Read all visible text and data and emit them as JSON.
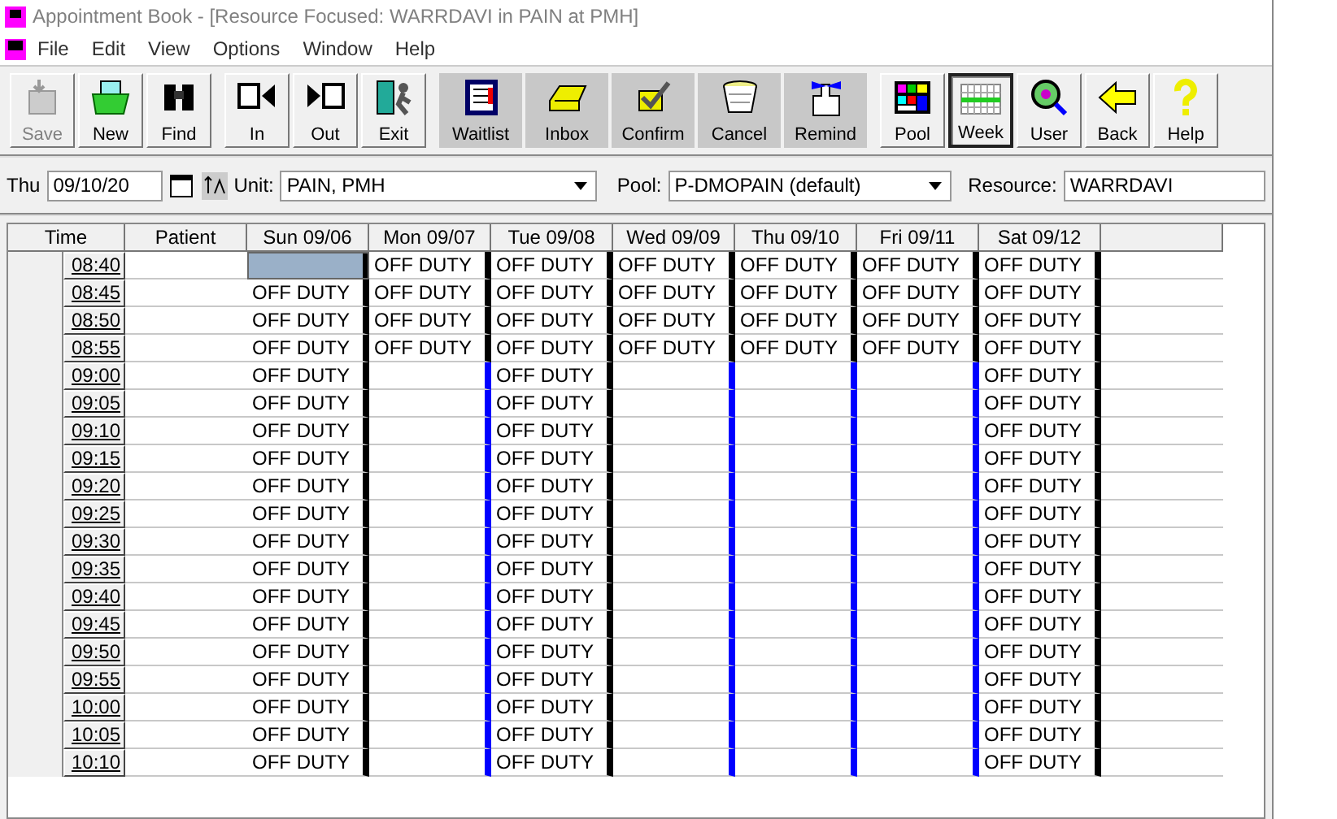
{
  "window": {
    "title": "Appointment Book - [Resource Focused:  WARRDAVI in PAIN at PMH]"
  },
  "menu": [
    "File",
    "Edit",
    "View",
    "Options",
    "Window",
    "Help"
  ],
  "toolbar": [
    {
      "label": "Save",
      "disabled": true,
      "selected": false
    },
    {
      "label": "New",
      "disabled": false,
      "selected": false
    },
    {
      "label": "Find",
      "disabled": false,
      "selected": false
    },
    {
      "label": "In",
      "disabled": false,
      "selected": false
    },
    {
      "label": "Out",
      "disabled": false,
      "selected": false
    },
    {
      "label": "Exit",
      "disabled": false,
      "selected": false
    },
    {
      "label": "Waitlist",
      "disabled": false,
      "selected": false
    },
    {
      "label": "Inbox",
      "disabled": false,
      "selected": false
    },
    {
      "label": "Confirm",
      "disabled": false,
      "selected": false
    },
    {
      "label": "Cancel",
      "disabled": false,
      "selected": false
    },
    {
      "label": "Remind",
      "disabled": false,
      "selected": false
    },
    {
      "label": "Pool",
      "disabled": false,
      "selected": false
    },
    {
      "label": "Week",
      "disabled": false,
      "selected": true
    },
    {
      "label": "User",
      "disabled": false,
      "selected": false
    },
    {
      "label": "Back",
      "disabled": false,
      "selected": false
    },
    {
      "label": "Help",
      "disabled": false,
      "selected": false
    }
  ],
  "filters": {
    "day": "Thu",
    "date": "09/10/20",
    "unit_label": "Unit:",
    "unit": "PAIN, PMH",
    "pool_label": "Pool:",
    "pool": "P-DMOPAIN (default)",
    "resource_label": "Resource:",
    "resource": "WARRDAVI"
  },
  "grid": {
    "time_header": "Time",
    "patient_header": "Patient",
    "times": [
      "08:40",
      "08:45",
      "08:50",
      "08:55",
      "09:00",
      "09:05",
      "09:10",
      "09:15",
      "09:20",
      "09:25",
      "09:30",
      "09:35",
      "09:40",
      "09:45",
      "09:50",
      "09:55",
      "10:00",
      "10:05",
      "10:10"
    ],
    "days": [
      {
        "label": "Sun 09/06",
        "slots": [
          {
            "selected": true,
            "kind": "blocked"
          },
          {
            "text": "OFF DUTY",
            "selected": false,
            "kind": "blocked"
          },
          {
            "text": "OFF DUTY",
            "selected": false,
            "kind": "blocked"
          },
          {
            "text": "OFF DUTY",
            "selected": false,
            "kind": "blocked"
          },
          {
            "text": "OFF DUTY",
            "selected": false,
            "kind": "blocked"
          },
          {
            "text": "OFF DUTY",
            "selected": false,
            "kind": "blocked"
          },
          {
            "text": "OFF DUTY",
            "selected": false,
            "kind": "blocked"
          },
          {
            "text": "OFF DUTY",
            "selected": false,
            "kind": "blocked"
          },
          {
            "text": "OFF DUTY",
            "selected": false,
            "kind": "blocked"
          },
          {
            "text": "OFF DUTY",
            "selected": false,
            "kind": "blocked"
          },
          {
            "text": "OFF DUTY",
            "selected": false,
            "kind": "blocked"
          },
          {
            "text": "OFF DUTY",
            "selected": false,
            "kind": "blocked"
          },
          {
            "text": "OFF DUTY",
            "selected": false,
            "kind": "blocked"
          },
          {
            "text": "OFF DUTY",
            "selected": false,
            "kind": "blocked"
          },
          {
            "text": "OFF DUTY",
            "selected": false,
            "kind": "blocked"
          },
          {
            "text": "OFF DUTY",
            "selected": false,
            "kind": "blocked"
          },
          {
            "text": "OFF DUTY",
            "selected": false,
            "kind": "blocked"
          },
          {
            "text": "OFF DUTY",
            "selected": false,
            "kind": "blocked"
          },
          {
            "text": "OFF DUTY",
            "selected": false,
            "kind": "blocked"
          }
        ]
      },
      {
        "label": "Mon 09/07",
        "slots": [
          {
            "text": "OFF DUTY",
            "selected": false,
            "kind": "blocked"
          },
          {
            "text": "OFF DUTY",
            "selected": false,
            "kind": "blocked"
          },
          {
            "text": "OFF DUTY",
            "selected": false,
            "kind": "blocked"
          },
          {
            "text": "OFF DUTY",
            "selected": false,
            "kind": "blocked"
          },
          {
            "selected": false,
            "kind": "open"
          },
          {
            "selected": false,
            "kind": "open"
          },
          {
            "selected": false,
            "kind": "open"
          },
          {
            "selected": false,
            "kind": "open"
          },
          {
            "selected": false,
            "kind": "open"
          },
          {
            "selected": false,
            "kind": "open"
          },
          {
            "selected": false,
            "kind": "open"
          },
          {
            "selected": false,
            "kind": "open"
          },
          {
            "selected": false,
            "kind": "open"
          },
          {
            "selected": false,
            "kind": "open"
          },
          {
            "selected": false,
            "kind": "open"
          },
          {
            "selected": false,
            "kind": "open"
          },
          {
            "selected": false,
            "kind": "open"
          },
          {
            "selected": false,
            "kind": "open"
          },
          {
            "selected": false,
            "kind": "open"
          }
        ]
      },
      {
        "label": "Tue 09/08",
        "slots": [
          {
            "text": "OFF DUTY",
            "selected": false,
            "kind": "blocked"
          },
          {
            "text": "OFF DUTY",
            "selected": false,
            "kind": "blocked"
          },
          {
            "text": "OFF DUTY",
            "selected": false,
            "kind": "blocked"
          },
          {
            "text": "OFF DUTY",
            "selected": false,
            "kind": "blocked"
          },
          {
            "text": "OFF DUTY",
            "selected": false,
            "kind": "blocked"
          },
          {
            "text": "OFF DUTY",
            "selected": false,
            "kind": "blocked"
          },
          {
            "text": "OFF DUTY",
            "selected": false,
            "kind": "blocked"
          },
          {
            "text": "OFF DUTY",
            "selected": false,
            "kind": "blocked"
          },
          {
            "text": "OFF DUTY",
            "selected": false,
            "kind": "blocked"
          },
          {
            "text": "OFF DUTY",
            "selected": false,
            "kind": "blocked"
          },
          {
            "text": "OFF DUTY",
            "selected": false,
            "kind": "blocked"
          },
          {
            "text": "OFF DUTY",
            "selected": false,
            "kind": "blocked"
          },
          {
            "text": "OFF DUTY",
            "selected": false,
            "kind": "blocked"
          },
          {
            "text": "OFF DUTY",
            "selected": false,
            "kind": "blocked"
          },
          {
            "text": "OFF DUTY",
            "selected": false,
            "kind": "blocked"
          },
          {
            "text": "OFF DUTY",
            "selected": false,
            "kind": "blocked"
          },
          {
            "text": "OFF DUTY",
            "selected": false,
            "kind": "blocked"
          },
          {
            "text": "OFF DUTY",
            "selected": false,
            "kind": "blocked"
          },
          {
            "text": "OFF DUTY",
            "selected": false,
            "kind": "blocked"
          }
        ]
      },
      {
        "label": "Wed 09/09",
        "slots": [
          {
            "text": "OFF DUTY",
            "selected": false,
            "kind": "blocked"
          },
          {
            "text": "OFF DUTY",
            "selected": false,
            "kind": "blocked"
          },
          {
            "text": "OFF DUTY",
            "selected": false,
            "kind": "blocked"
          },
          {
            "text": "OFF DUTY",
            "selected": false,
            "kind": "blocked"
          },
          {
            "selected": false,
            "kind": "open"
          },
          {
            "selected": false,
            "kind": "open"
          },
          {
            "selected": false,
            "kind": "open"
          },
          {
            "selected": false,
            "kind": "open"
          },
          {
            "selected": false,
            "kind": "open"
          },
          {
            "selected": false,
            "kind": "open"
          },
          {
            "selected": false,
            "kind": "open"
          },
          {
            "selected": false,
            "kind": "open"
          },
          {
            "selected": false,
            "kind": "open"
          },
          {
            "selected": false,
            "kind": "open"
          },
          {
            "selected": false,
            "kind": "open"
          },
          {
            "selected": false,
            "kind": "open"
          },
          {
            "selected": false,
            "kind": "open"
          },
          {
            "selected": false,
            "kind": "open"
          },
          {
            "selected": false,
            "kind": "open"
          }
        ]
      },
      {
        "label": "Thu 09/10",
        "slots": [
          {
            "text": "OFF DUTY",
            "selected": false,
            "kind": "blocked"
          },
          {
            "text": "OFF DUTY",
            "selected": false,
            "kind": "blocked"
          },
          {
            "text": "OFF DUTY",
            "selected": false,
            "kind": "blocked"
          },
          {
            "text": "OFF DUTY",
            "selected": false,
            "kind": "blocked"
          },
          {
            "selected": false,
            "kind": "open"
          },
          {
            "selected": false,
            "kind": "open"
          },
          {
            "selected": false,
            "kind": "open"
          },
          {
            "selected": false,
            "kind": "open"
          },
          {
            "selected": false,
            "kind": "open"
          },
          {
            "selected": false,
            "kind": "open"
          },
          {
            "selected": false,
            "kind": "open"
          },
          {
            "selected": false,
            "kind": "open"
          },
          {
            "selected": false,
            "kind": "open"
          },
          {
            "selected": false,
            "kind": "open"
          },
          {
            "selected": false,
            "kind": "open"
          },
          {
            "selected": false,
            "kind": "open"
          },
          {
            "selected": false,
            "kind": "open"
          },
          {
            "selected": false,
            "kind": "open"
          },
          {
            "selected": false,
            "kind": "open"
          }
        ]
      },
      {
        "label": "Fri 09/11",
        "slots": [
          {
            "text": "OFF DUTY",
            "selected": false,
            "kind": "blocked"
          },
          {
            "text": "OFF DUTY",
            "selected": false,
            "kind": "blocked"
          },
          {
            "text": "OFF DUTY",
            "selected": false,
            "kind": "blocked"
          },
          {
            "text": "OFF DUTY",
            "selected": false,
            "kind": "blocked"
          },
          {
            "selected": false,
            "kind": "open"
          },
          {
            "selected": false,
            "kind": "open"
          },
          {
            "selected": false,
            "kind": "open"
          },
          {
            "selected": false,
            "kind": "open"
          },
          {
            "selected": false,
            "kind": "open"
          },
          {
            "selected": false,
            "kind": "open"
          },
          {
            "selected": false,
            "kind": "open"
          },
          {
            "selected": false,
            "kind": "open"
          },
          {
            "selected": false,
            "kind": "open"
          },
          {
            "selected": false,
            "kind": "open"
          },
          {
            "selected": false,
            "kind": "open"
          },
          {
            "selected": false,
            "kind": "open"
          },
          {
            "selected": false,
            "kind": "open"
          },
          {
            "selected": false,
            "kind": "open"
          },
          {
            "selected": false,
            "kind": "open"
          }
        ]
      },
      {
        "label": "Sat 09/12",
        "slots": [
          {
            "text": "OFF DUTY",
            "selected": false,
            "kind": "blocked"
          },
          {
            "text": "OFF DUTY",
            "selected": false,
            "kind": "blocked"
          },
          {
            "text": "OFF DUTY",
            "selected": false,
            "kind": "blocked"
          },
          {
            "text": "OFF DUTY",
            "selected": false,
            "kind": "blocked"
          },
          {
            "text": "OFF DUTY",
            "selected": false,
            "kind": "blocked"
          },
          {
            "text": "OFF DUTY",
            "selected": false,
            "kind": "blocked"
          },
          {
            "text": "OFF DUTY",
            "selected": false,
            "kind": "blocked"
          },
          {
            "text": "OFF DUTY",
            "selected": false,
            "kind": "blocked"
          },
          {
            "text": "OFF DUTY",
            "selected": false,
            "kind": "blocked"
          },
          {
            "text": "OFF DUTY",
            "selected": false,
            "kind": "blocked"
          },
          {
            "text": "OFF DUTY",
            "selected": false,
            "kind": "blocked"
          },
          {
            "text": "OFF DUTY",
            "selected": false,
            "kind": "blocked"
          },
          {
            "text": "OFF DUTY",
            "selected": false,
            "kind": "blocked"
          },
          {
            "text": "OFF DUTY",
            "selected": false,
            "kind": "blocked"
          },
          {
            "text": "OFF DUTY",
            "selected": false,
            "kind": "blocked"
          },
          {
            "text": "OFF DUTY",
            "selected": false,
            "kind": "blocked"
          },
          {
            "text": "OFF DUTY",
            "selected": false,
            "kind": "blocked"
          },
          {
            "text": "OFF DUTY",
            "selected": false,
            "kind": "blocked"
          },
          {
            "text": "OFF DUTY",
            "selected": false,
            "kind": "blocked"
          }
        ]
      }
    ]
  }
}
